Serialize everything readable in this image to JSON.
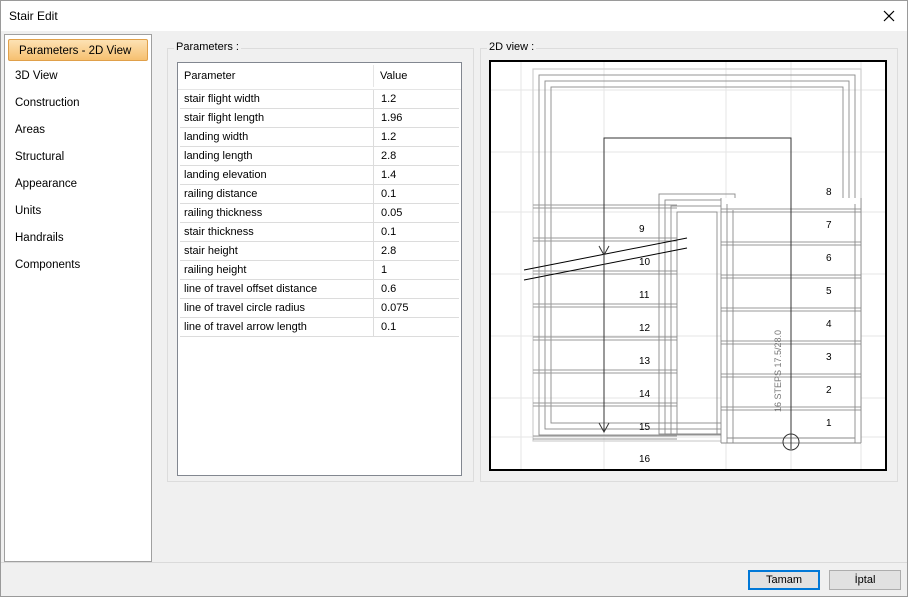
{
  "window": {
    "title": "Stair Edit"
  },
  "sidebar": {
    "items": [
      {
        "label": "Parameters - 2D View",
        "active": true
      },
      {
        "label": "3D View"
      },
      {
        "label": "Construction"
      },
      {
        "label": "Areas"
      },
      {
        "label": "Structural"
      },
      {
        "label": "Appearance"
      },
      {
        "label": "Units"
      },
      {
        "label": "Handrails"
      },
      {
        "label": "Components"
      }
    ]
  },
  "parameters": {
    "group_label": "Parameters :",
    "columns": [
      "Parameter",
      "Value"
    ],
    "rows": [
      [
        "stair flight width",
        "1.2"
      ],
      [
        "stair flight length",
        "1.96"
      ],
      [
        "landing width",
        "1.2"
      ],
      [
        "landing length",
        "2.8"
      ],
      [
        "landing elevation",
        "1.4"
      ],
      [
        "railing distance",
        "0.1"
      ],
      [
        "railing thickness",
        "0.05"
      ],
      [
        "stair thickness",
        "0.1"
      ],
      [
        "stair height",
        "2.8"
      ],
      [
        "railing height",
        "1"
      ],
      [
        "line of travel offset distance",
        "0.6"
      ],
      [
        "line of travel circle radius",
        "0.075"
      ],
      [
        "line of travel arrow length",
        "0.1"
      ]
    ]
  },
  "view2d": {
    "group_label": "2D view :",
    "steps_label": "16 STEPS 17.5/28.0",
    "right_steps": [
      "1",
      "2",
      "3",
      "4",
      "5",
      "6",
      "7",
      "8"
    ],
    "left_steps": [
      "9",
      "10",
      "11",
      "12",
      "13",
      "14",
      "15",
      "16"
    ]
  },
  "buttons": {
    "ok": "Tamam",
    "cancel": "İptal"
  }
}
